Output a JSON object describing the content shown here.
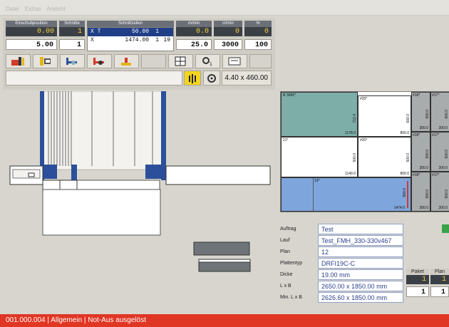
{
  "menu": [
    "Datei",
    "Extras",
    "Ansicht"
  ],
  "params": {
    "einschub": {
      "header": "Einschubposition",
      "actual": "0.00",
      "set": "5.00"
    },
    "schnitte": {
      "header": "Schnitte",
      "actual": "1",
      "set": "1"
    },
    "schnittzeilen": {
      "header": "Schnittzeilen",
      "rows": [
        {
          "axis": "X T",
          "value": "50.00",
          "a": "1",
          "b": ""
        },
        {
          "axis": "X",
          "value": "1474.00",
          "a": "1",
          "b": "19"
        }
      ]
    },
    "mmin": {
      "header": "m/min",
      "actual": "0.0",
      "set": "25.0"
    },
    "umin": {
      "header": "U/min",
      "actual": "0",
      "set": "3000"
    },
    "pct": {
      "header": "%",
      "actual": "0",
      "set": "100"
    }
  },
  "toolbar2": {
    "saw_readout": "4.40 x 460.00"
  },
  "plates": [
    {
      "label": "R 3095*",
      "dim_w": "1178.0",
      "dim_h": "712.4"
    },
    {
      "label": "#20*",
      "dim_w": "800.0",
      "dim_h": "600.0"
    },
    {
      "label": "21*",
      "dim_w": "1149.0",
      "dim_h": "500.0"
    },
    {
      "label": "#20*",
      "dim_w": "800.0",
      "dim_h": "500.0"
    },
    {
      "label": "19*",
      "dim_w": "1474.0",
      "dim_h": "500.0"
    },
    {
      "label": "#18*",
      "dim_w": "300.0",
      "dim_h": "600.0"
    },
    {
      "label": "#17*",
      "dim_w": "300.0",
      "dim_h": "600.0"
    },
    {
      "label": "#18*",
      "dim_w": "300.0",
      "dim_h": "500.0"
    },
    {
      "label": "#17*",
      "dim_w": "300.0",
      "dim_h": "500.0"
    },
    {
      "label": "#18*",
      "dim_w": "300.0",
      "dim_h": "500.0"
    },
    {
      "label": "#17*",
      "dim_w": "300.0",
      "dim_h": "500.0"
    }
  ],
  "info": {
    "auftrag": {
      "label": "Auftrag",
      "value": "Test"
    },
    "lauf": {
      "label": "Lauf",
      "value": "Test_FMH_330-330v467"
    },
    "plan": {
      "label": "Plan",
      "value": "12"
    },
    "plattentyp": {
      "label": "Plattentyp",
      "value": "DRFI19C-C"
    },
    "dicke": {
      "label": "Dicke",
      "value": "19.00 mm"
    },
    "lxb": {
      "label": "L x B",
      "value": "2650.00 x 1850.00 mm"
    },
    "minlxb": {
      "label": "Min. L x B",
      "value": "2626.60 x 1850.00 mm"
    }
  },
  "counters": {
    "paket": {
      "header": "Paket",
      "actual": "1",
      "set": "1"
    },
    "plan": {
      "header": "Plan",
      "actual": "1",
      "set": "1"
    }
  },
  "status": "001.000.004 | Allgemein | Not-Aus ausgelöst"
}
